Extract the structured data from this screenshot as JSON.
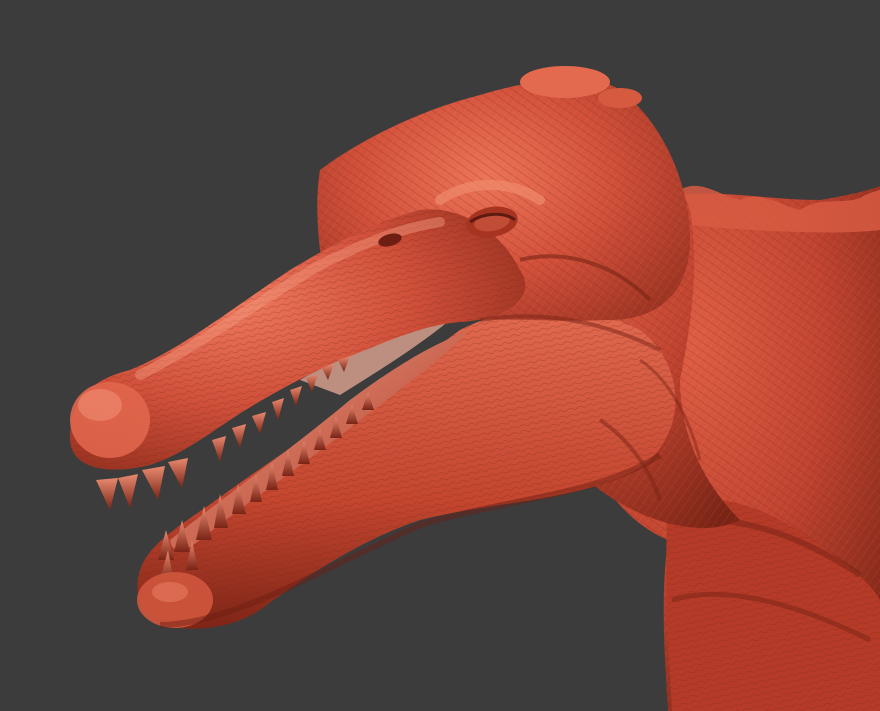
{
  "scene": {
    "subject": "dinosaur-sculpt",
    "colors": {
      "background": "#3c3c3c",
      "clay_base": "#c9452f",
      "clay_light": "#e2664c",
      "clay_highlight": "#f08a6c",
      "clay_shadow": "#8a2a1a",
      "clay_deep": "#5e1a10",
      "mouth_interior": "#b23a28"
    }
  }
}
